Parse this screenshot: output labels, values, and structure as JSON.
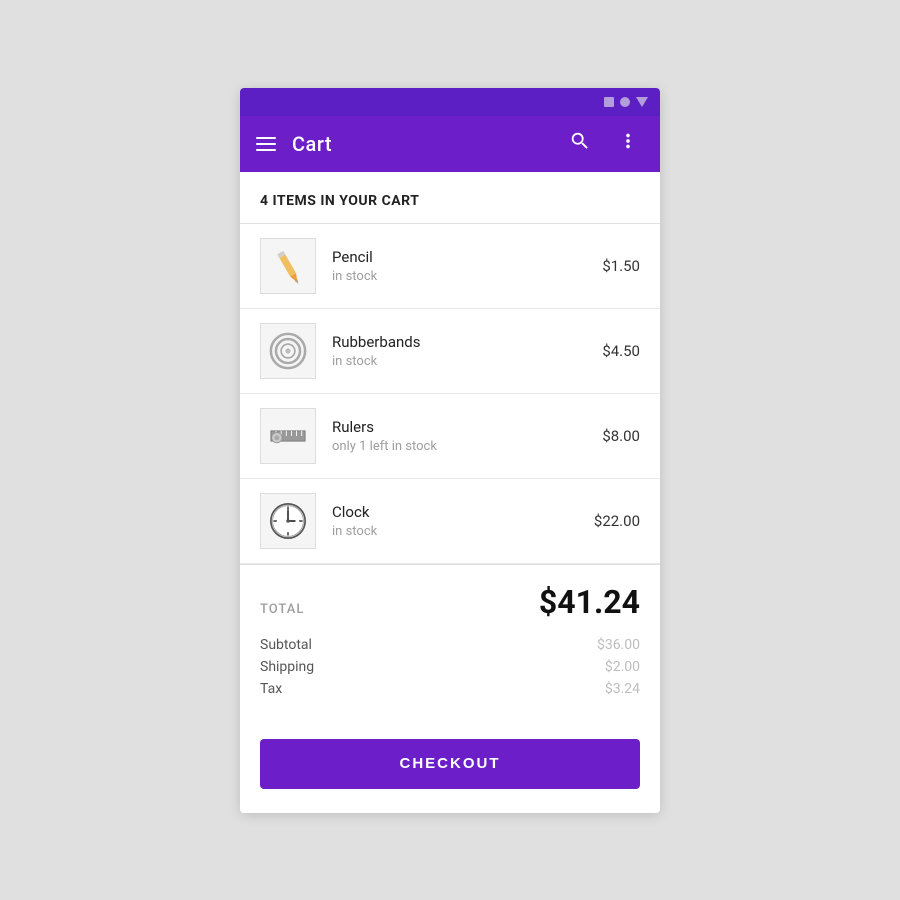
{
  "statusBar": {
    "icons": [
      "square",
      "circle",
      "triangle"
    ]
  },
  "appBar": {
    "title": "Cart",
    "menuIcon": "menu-icon",
    "searchIcon": "⌕",
    "moreIcon": "⋮"
  },
  "cart": {
    "headerText": "4 ITEMS IN YOUR CART",
    "items": [
      {
        "id": "pencil",
        "name": "Pencil",
        "status": "in stock",
        "price": "$1.50",
        "lowStock": false
      },
      {
        "id": "rubberbands",
        "name": "Rubberbands",
        "status": "in stock",
        "price": "$4.50",
        "lowStock": false
      },
      {
        "id": "rulers",
        "name": "Rulers",
        "status": "only 1 left in stock",
        "price": "$8.00",
        "lowStock": true
      },
      {
        "id": "clock",
        "name": "Clock",
        "status": "in stock",
        "price": "$22.00",
        "lowStock": false
      }
    ],
    "total": {
      "label": "TOTAL",
      "amount": "$41.24",
      "subtotalLabel": "Subtotal",
      "subtotalValue": "$36.00",
      "shippingLabel": "Shipping",
      "shippingValue": "$2.00",
      "taxLabel": "Tax",
      "taxValue": "$3.24"
    },
    "checkoutLabel": "CHECKOUT"
  }
}
